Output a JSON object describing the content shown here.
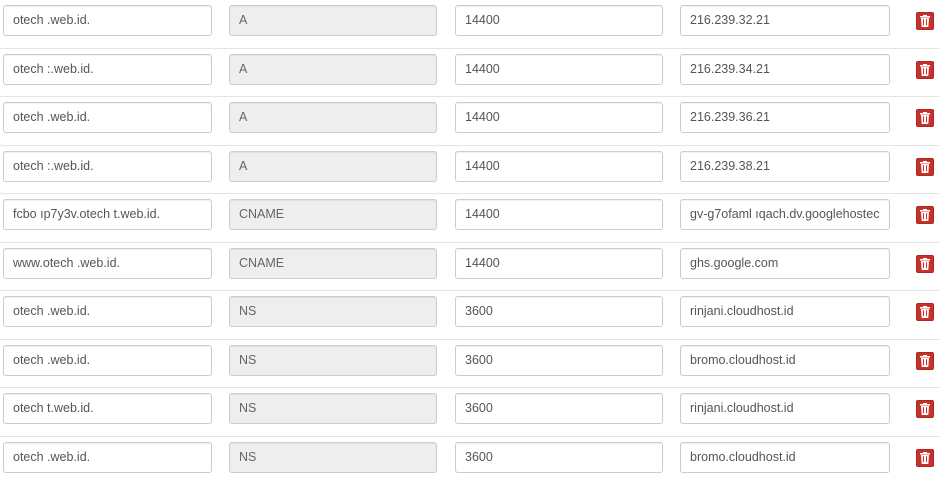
{
  "records": [
    {
      "name": "otech     .web.id.",
      "type": "A",
      "ttl": "14400",
      "value": "216.239.32.21"
    },
    {
      "name": "otech     :.web.id.",
      "type": "A",
      "ttl": "14400",
      "value": "216.239.34.21"
    },
    {
      "name": "otech     .web.id.",
      "type": "A",
      "ttl": "14400",
      "value": "216.239.36.21"
    },
    {
      "name": "otech     :.web.id.",
      "type": "A",
      "ttl": "14400",
      "value": "216.239.38.21"
    },
    {
      "name": "fcbo      ıp7y3v.otech     t.web.id.",
      "type": "CNAME",
      "ttl": "14400",
      "value": "gv-g7ofaml     ıqach.dv.googlehostec"
    },
    {
      "name": "www.otech      .web.id.",
      "type": "CNAME",
      "ttl": "14400",
      "value": "ghs.google.com"
    },
    {
      "name": "otech     .web.id.",
      "type": "NS",
      "ttl": "3600",
      "value": "rinjani.cloudhost.id"
    },
    {
      "name": "otech     .web.id.",
      "type": "NS",
      "ttl": "3600",
      "value": "bromo.cloudhost.id"
    },
    {
      "name": "otech     t.web.id.",
      "type": "NS",
      "ttl": "3600",
      "value": "rinjani.cloudhost.id"
    },
    {
      "name": "otech     .web.id.",
      "type": "NS",
      "ttl": "3600",
      "value": "bromo.cloudhost.id"
    }
  ],
  "icons": {
    "delete": "trash-icon"
  },
  "colors": {
    "delete_button": "#c9302c",
    "readonly_field": "#eeeeee",
    "field_border": "#cccccc"
  }
}
